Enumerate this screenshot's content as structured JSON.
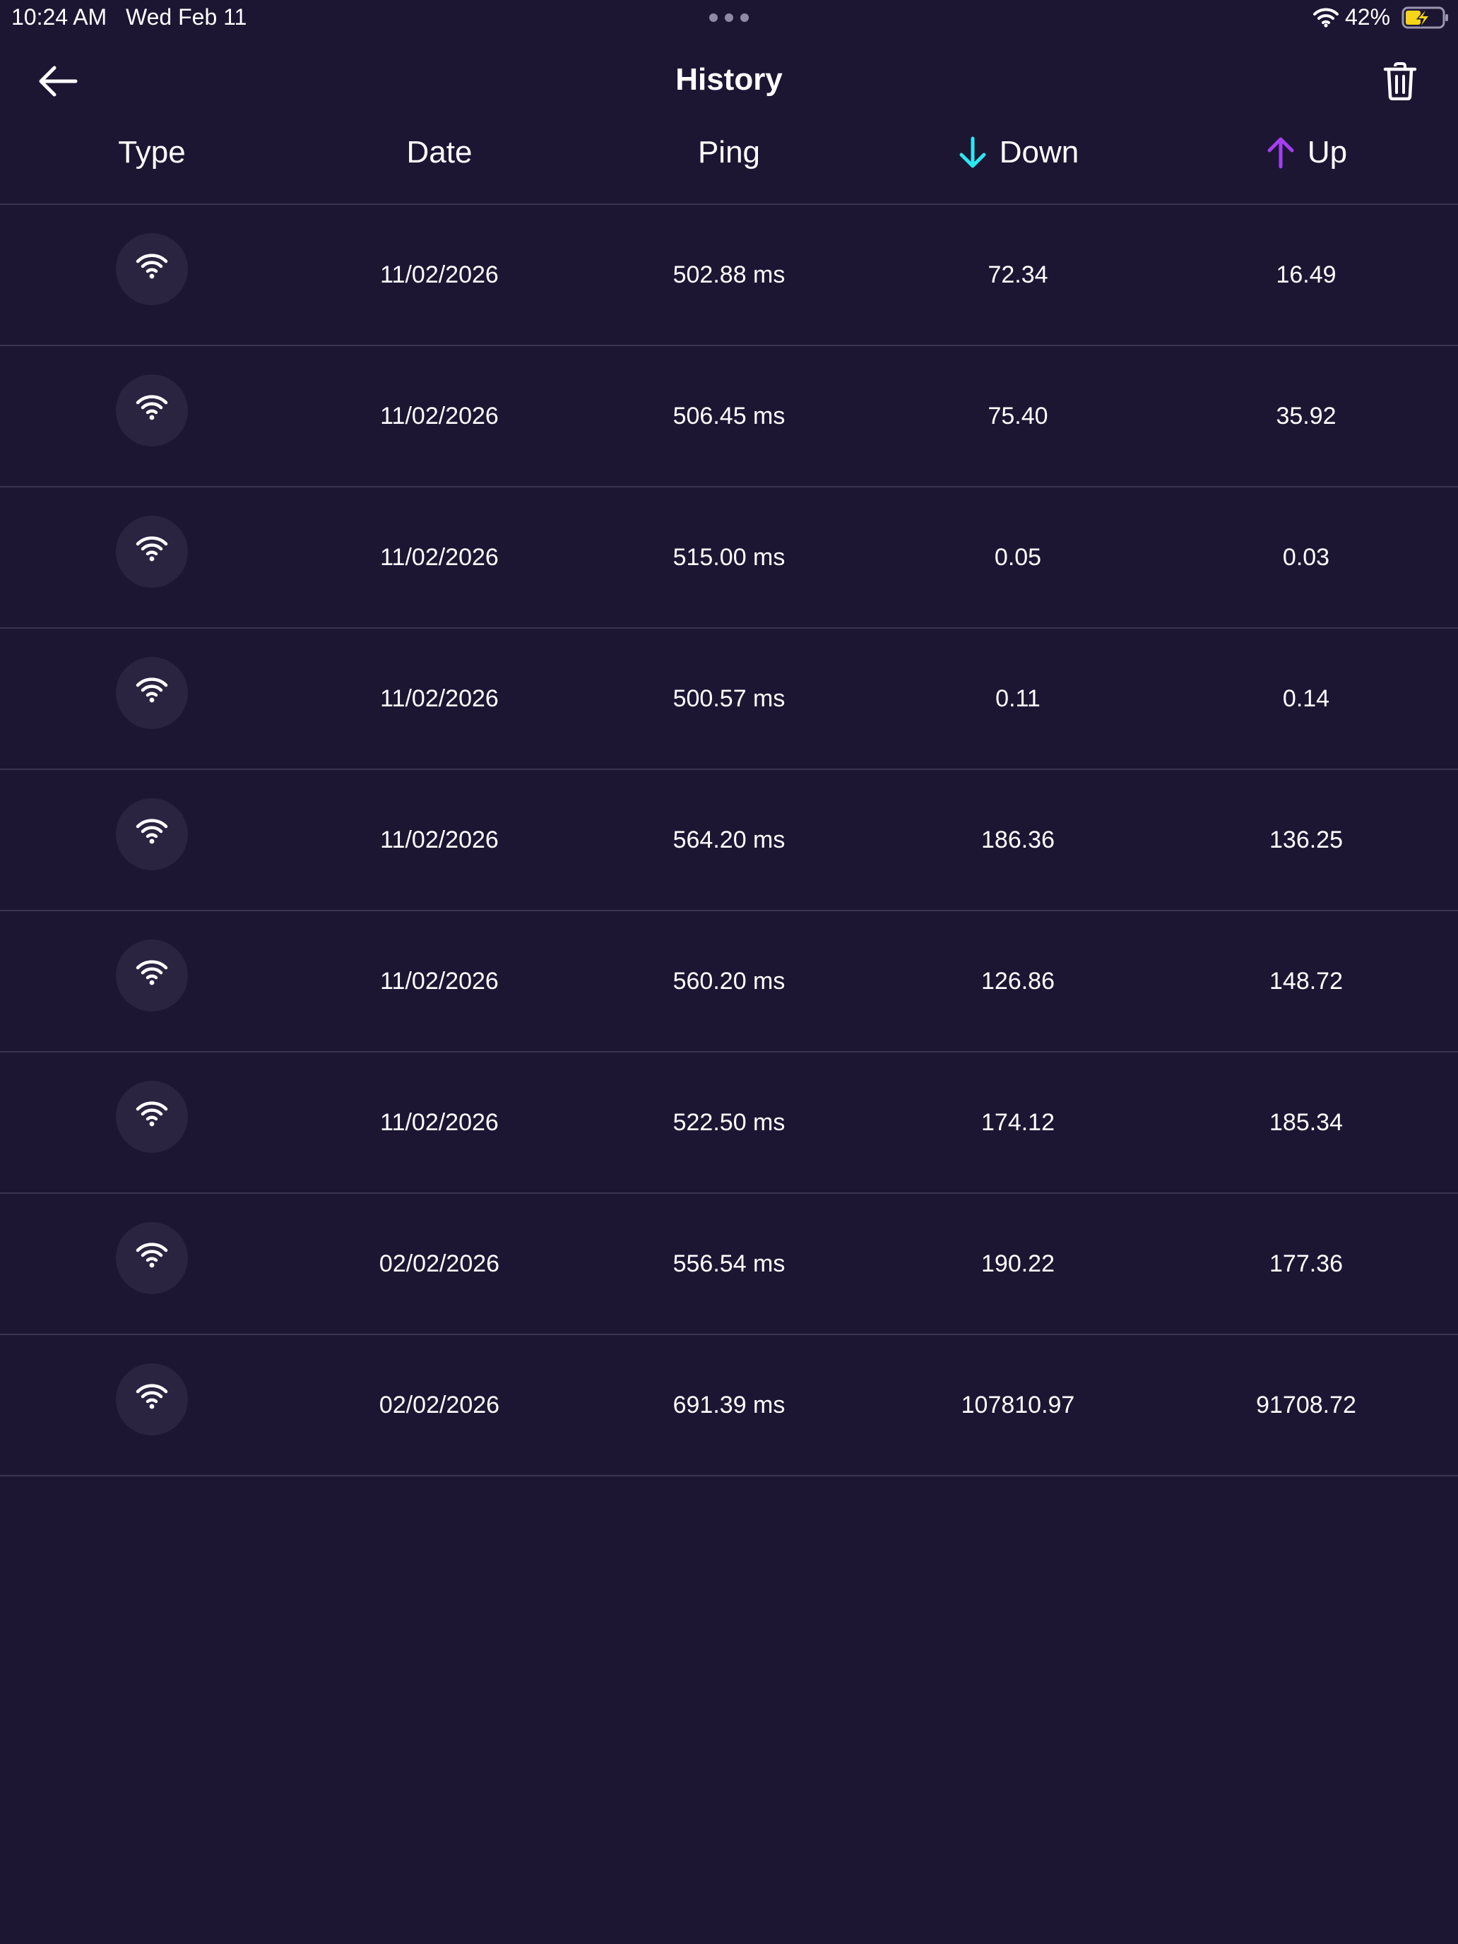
{
  "status_bar": {
    "time": "10:24 AM",
    "date": "Wed Feb 11",
    "battery_percent": "42%",
    "battery_fill": 0.42,
    "battery_color": "#f5d419",
    "icons": [
      "wifi-icon",
      "battery-charging-icon"
    ]
  },
  "header": {
    "title": "History",
    "back_icon": "arrow-left-icon",
    "delete_icon": "trash-icon"
  },
  "columns": {
    "type": "Type",
    "date": "Date",
    "ping": "Ping",
    "down": "Down",
    "up": "Up",
    "down_icon": "arrow-down-icon",
    "up_icon": "arrow-up-icon",
    "down_color": "#2ee6f0",
    "up_color": "#a43ef0"
  },
  "rows": [
    {
      "type_icon": "wifi-icon",
      "date": "11/02/2026",
      "ping": "502.88 ms",
      "down": "72.34",
      "up": "16.49"
    },
    {
      "type_icon": "wifi-icon",
      "date": "11/02/2026",
      "ping": "506.45 ms",
      "down": "75.40",
      "up": "35.92"
    },
    {
      "type_icon": "wifi-icon",
      "date": "11/02/2026",
      "ping": "515.00 ms",
      "down": "0.05",
      "up": "0.03"
    },
    {
      "type_icon": "wifi-icon",
      "date": "11/02/2026",
      "ping": "500.57 ms",
      "down": "0.11",
      "up": "0.14"
    },
    {
      "type_icon": "wifi-icon",
      "date": "11/02/2026",
      "ping": "564.20 ms",
      "down": "186.36",
      "up": "136.25"
    },
    {
      "type_icon": "wifi-icon",
      "date": "11/02/2026",
      "ping": "560.20 ms",
      "down": "126.86",
      "up": "148.72"
    },
    {
      "type_icon": "wifi-icon",
      "date": "11/02/2026",
      "ping": "522.50 ms",
      "down": "174.12",
      "up": "185.34"
    },
    {
      "type_icon": "wifi-icon",
      "date": "02/02/2026",
      "ping": "556.54 ms",
      "down": "190.22",
      "up": "177.36"
    },
    {
      "type_icon": "wifi-icon",
      "date": "02/02/2026",
      "ping": "691.39 ms",
      "down": "107810.97",
      "up": "91708.72"
    }
  ],
  "theme": {
    "background": "#1c1633",
    "divider": "#3a3452",
    "badge": "#2a2440"
  }
}
